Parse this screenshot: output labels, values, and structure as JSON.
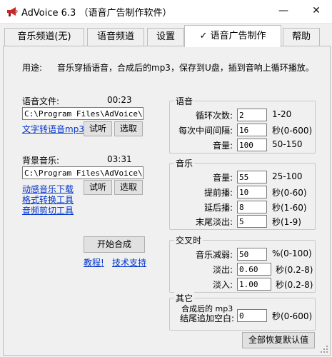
{
  "window": {
    "title": "AdVoice 6.3 （语音广告制作软件）",
    "minimize": "—",
    "close": "✕"
  },
  "tabs": [
    {
      "label": "音乐频道(无)"
    },
    {
      "label": "语音频道"
    },
    {
      "label": "设置"
    },
    {
      "label": "✓ 语音广告制作",
      "active": true
    },
    {
      "label": "帮助"
    }
  ],
  "usage": {
    "label": "用途:",
    "text": "音乐穿插语音，合成后的mp3，保存到U盘，插到音响上循环播放。"
  },
  "voice_file": {
    "label": "语音文件:",
    "duration": "00:23",
    "path": "C:\\Program Files\\AdVoice\\mu",
    "tts_link": "文字转语音mp3",
    "listen": "试听",
    "select": "选取"
  },
  "bg_music": {
    "label": "背景音乐:",
    "duration": "03:31",
    "path": "C:\\Program Files\\AdVoice\\mu",
    "links": [
      "动感音乐下载",
      "格式转换工具",
      "音频剪切工具"
    ],
    "listen": "试听",
    "select": "选取"
  },
  "start_button": "开始合成",
  "tutorial_link": "教程!",
  "support_link": "技术支持",
  "voice_group": {
    "title": "语音",
    "rows": [
      {
        "label": "循环次数:",
        "value": "2",
        "unit": "1-20"
      },
      {
        "label": "每次中间间隔:",
        "value": "16",
        "unit": "秒(0-600)"
      },
      {
        "label": "音量:",
        "value": "100",
        "unit": "50-150"
      }
    ]
  },
  "music_group": {
    "title": "音乐",
    "rows": [
      {
        "label": "音量:",
        "value": "55",
        "unit": "25-100"
      },
      {
        "label": "提前播:",
        "value": "10",
        "unit": "秒(0-60)"
      },
      {
        "label": "延后播:",
        "value": "8",
        "unit": "秒(1-60)"
      },
      {
        "label": "末尾淡出:",
        "value": "5",
        "unit": "秒(1-9)"
      }
    ]
  },
  "cross_group": {
    "title": "交叉时",
    "rows": [
      {
        "label": "音乐减弱:",
        "value": "50",
        "unit": "%(0-100)"
      },
      {
        "label": "淡出:",
        "value": "0.60",
        "unit": "秒(0.2-8)"
      },
      {
        "label": "淡入:",
        "value": "1.00",
        "unit": "秒(0.2-8)"
      }
    ]
  },
  "other_group": {
    "title": "其它",
    "label_line1": "合成后的 mp3",
    "label_line2": "结尾追加空白:",
    "value": "0",
    "unit": "秒(0-600)"
  },
  "reset_button": "全部恢复默认值"
}
